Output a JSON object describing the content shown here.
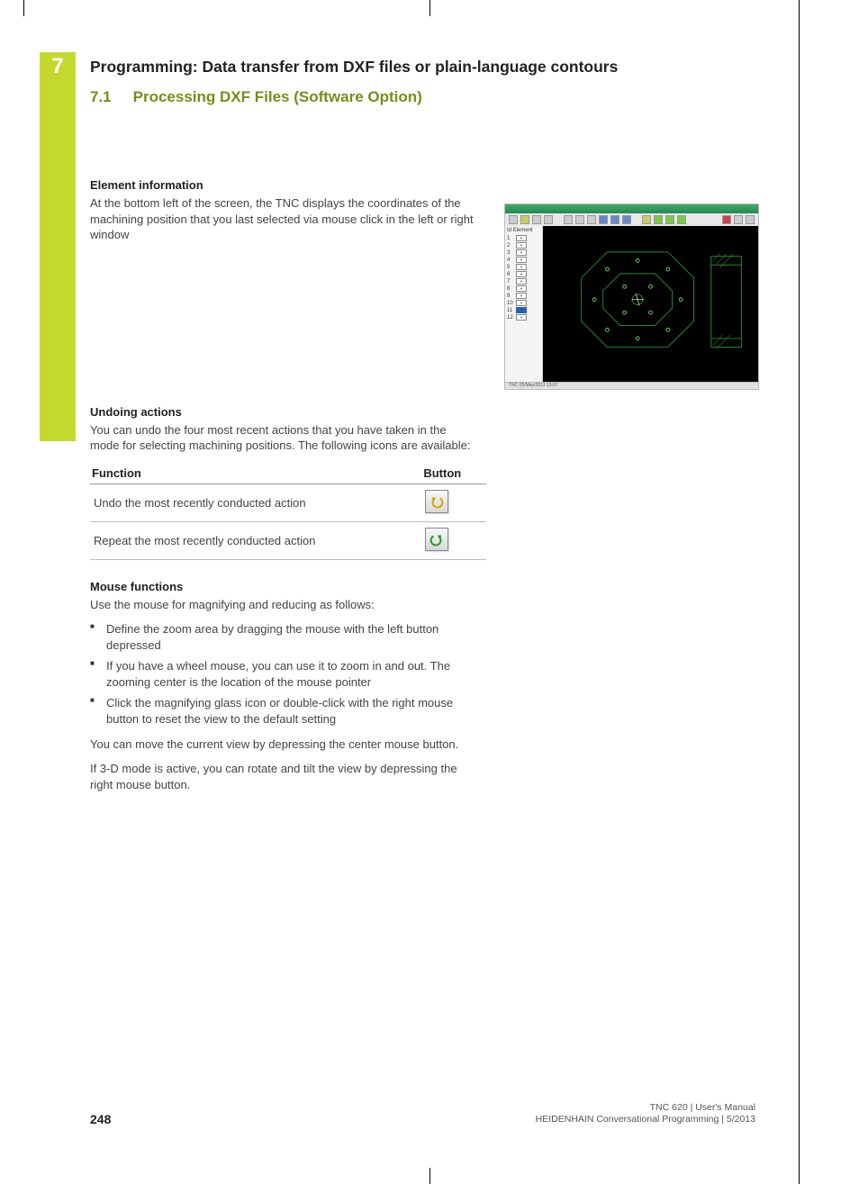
{
  "chapter": {
    "number": "7",
    "title": "Programming: Data transfer from DXF files or plain-language contours"
  },
  "section": {
    "number": "7.1",
    "title": "Processing DXF Files (Software Option)"
  },
  "element_info": {
    "heading": "Element information",
    "text": "At the bottom left of the screen, the TNC displays the coordinates of the machining position that you last selected via mouse click in the left or right window"
  },
  "undoing": {
    "heading": "Undoing actions",
    "text": "You can undo the four most recent actions that you have taken in the mode for selecting machining positions. The following icons are available:"
  },
  "func_table": {
    "col1": "Function",
    "col2": "Button",
    "rows": [
      {
        "label": "Undo the most recently conducted action",
        "icon": "undo"
      },
      {
        "label": "Repeat the most recently conducted action",
        "icon": "redo"
      }
    ]
  },
  "mouse": {
    "heading": "Mouse functions",
    "intro": "Use the mouse for magnifying and reducing as follows:",
    "bullets": [
      "Define the zoom area by dragging the mouse with the left button depressed",
      "If you have a wheel mouse, you can use it to zoom in and out. The zooming center is the location of the mouse pointer",
      "Click the magnifying glass icon or double-click with the right mouse button to reset the view to the default setting"
    ],
    "para1": "You can move the current view by depressing the center mouse button.",
    "para2": "If 3-D mode is active, you can rotate and tilt the view by depressing the right mouse button."
  },
  "screenshot": {
    "side_header_id": "Id",
    "side_header_elem": "Element",
    "rows": [
      "1",
      "2",
      "3",
      "4",
      "5",
      "6",
      "7",
      "8",
      "9",
      "10",
      "11",
      "12"
    ],
    "highlighted": "11",
    "status": "TNC   05/May/2013   13:07"
  },
  "footer": {
    "page": "248",
    "line1": "TNC 620 | User's Manual",
    "line2": "HEIDENHAIN Conversational Programming | 5/2013"
  }
}
